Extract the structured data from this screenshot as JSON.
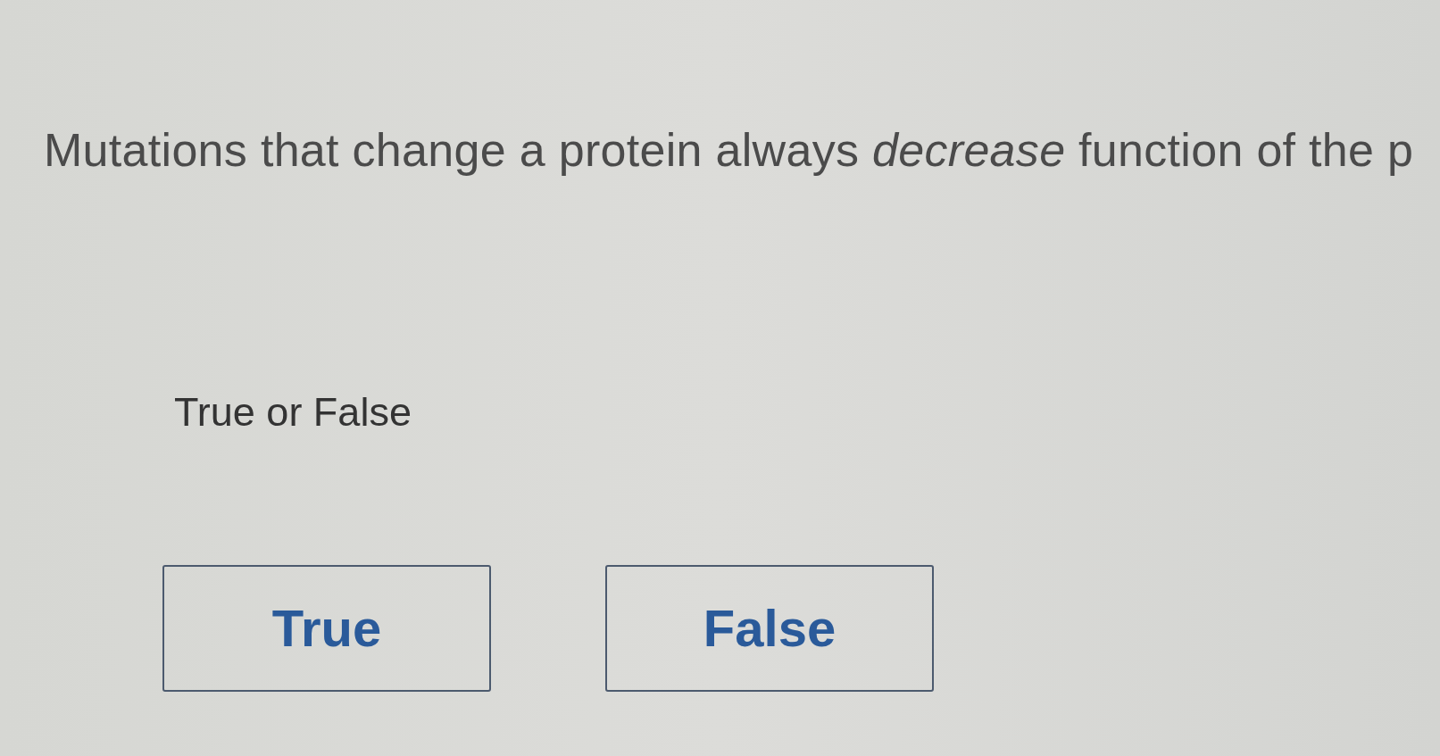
{
  "question": "Mutations that change a protein always *decrease* function of the p",
  "prompt": "True or False",
  "options": [
    {
      "label": "True",
      "selected": false
    },
    {
      "label": "False",
      "selected": false
    }
  ]
}
